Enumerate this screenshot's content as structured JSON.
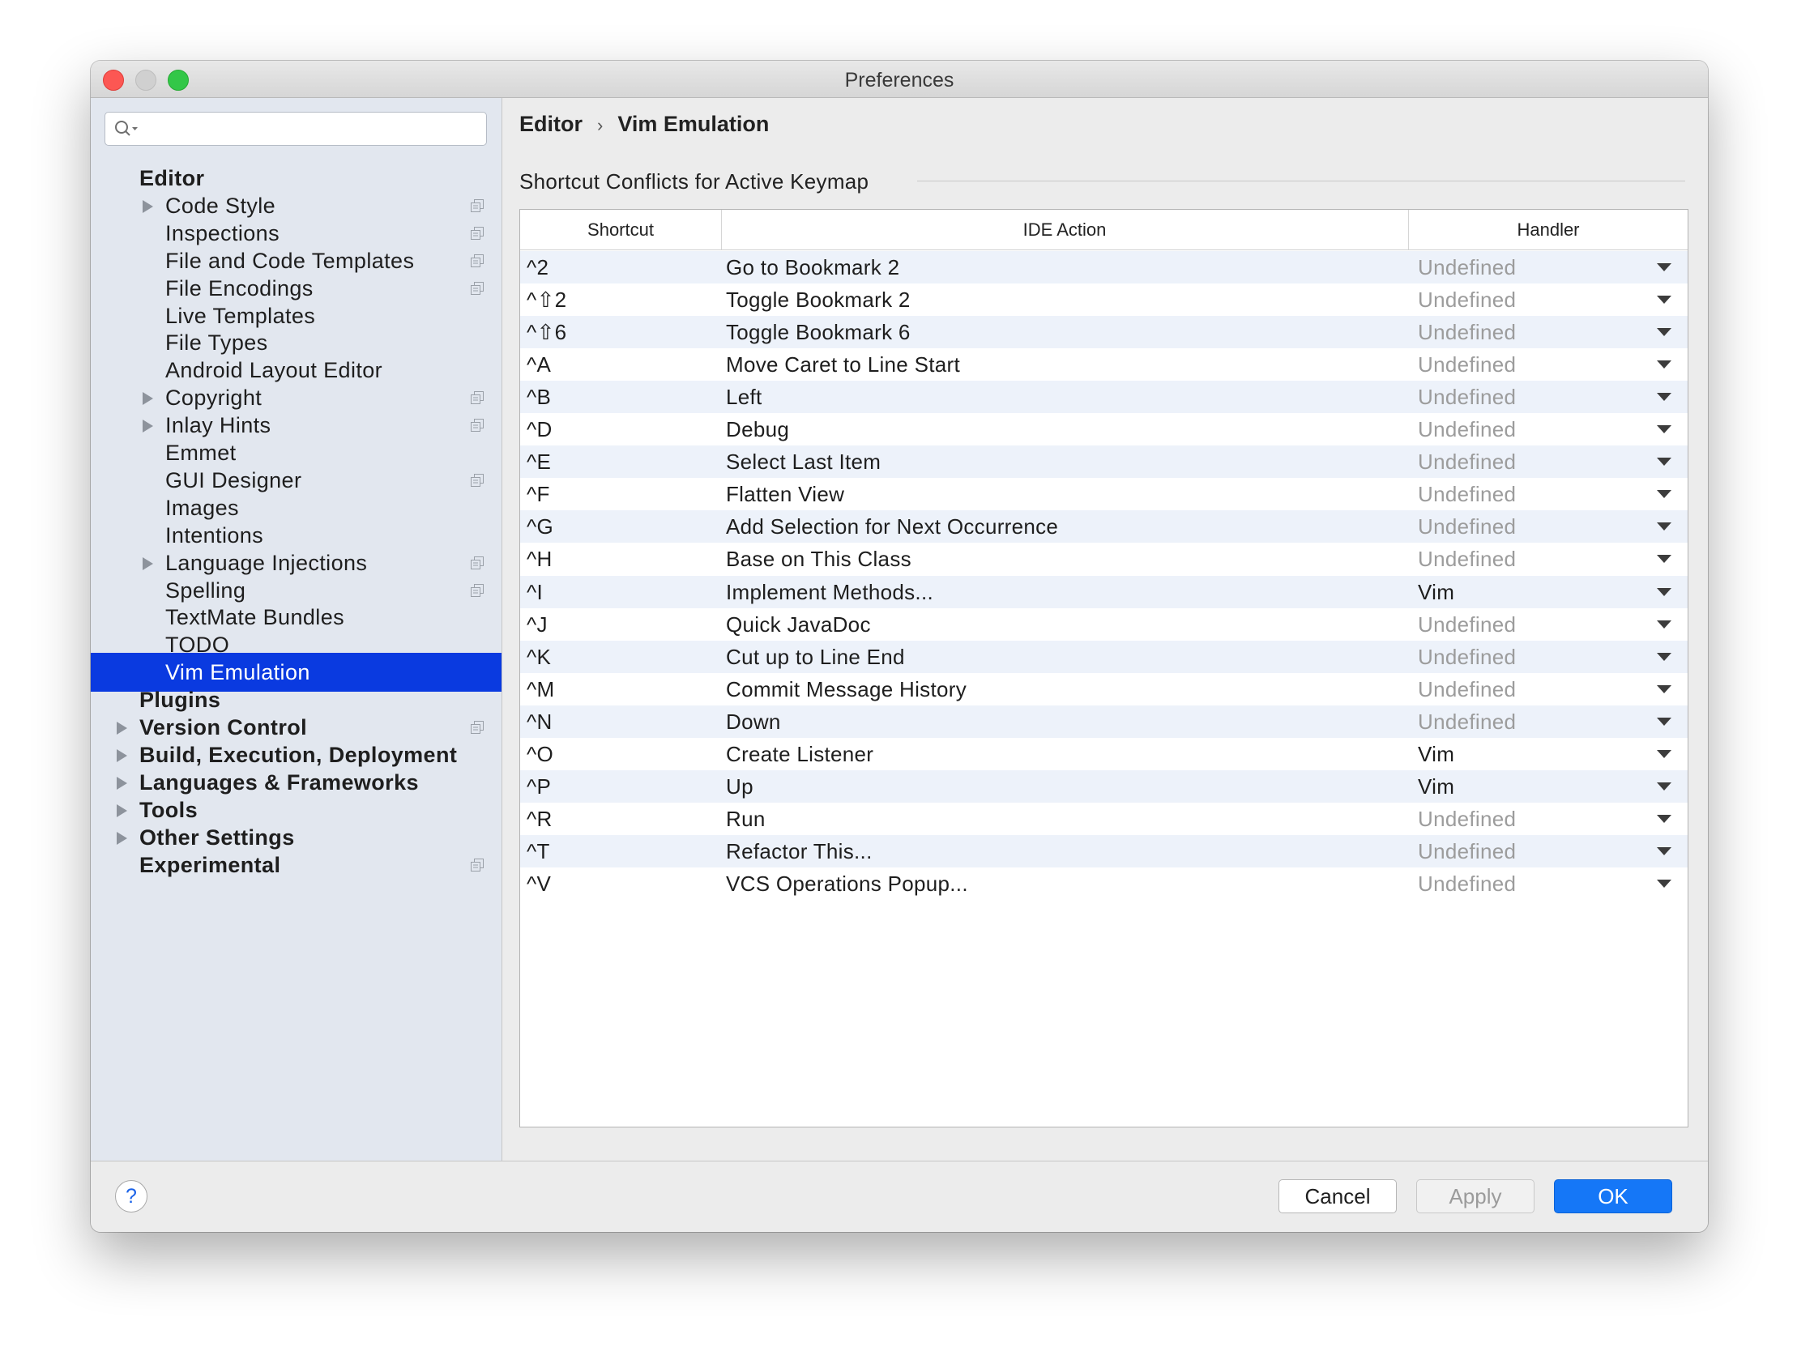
{
  "window": {
    "title": "Preferences"
  },
  "search": {
    "placeholder": ""
  },
  "sidebar": {
    "items": [
      {
        "label": "Editor",
        "level": "top",
        "arrow": false,
        "project": false,
        "selected": false
      },
      {
        "label": "Code Style",
        "level": "sub",
        "arrow": true,
        "project": true,
        "selected": false
      },
      {
        "label": "Inspections",
        "level": "sub",
        "arrow": false,
        "project": true,
        "selected": false
      },
      {
        "label": "File and Code Templates",
        "level": "sub",
        "arrow": false,
        "project": true,
        "selected": false
      },
      {
        "label": "File Encodings",
        "level": "sub",
        "arrow": false,
        "project": true,
        "selected": false
      },
      {
        "label": "Live Templates",
        "level": "sub",
        "arrow": false,
        "project": false,
        "selected": false
      },
      {
        "label": "File Types",
        "level": "sub",
        "arrow": false,
        "project": false,
        "selected": false
      },
      {
        "label": "Android Layout Editor",
        "level": "sub",
        "arrow": false,
        "project": false,
        "selected": false
      },
      {
        "label": "Copyright",
        "level": "sub",
        "arrow": true,
        "project": true,
        "selected": false
      },
      {
        "label": "Inlay Hints",
        "level": "sub",
        "arrow": true,
        "project": true,
        "selected": false
      },
      {
        "label": "Emmet",
        "level": "sub",
        "arrow": false,
        "project": false,
        "selected": false
      },
      {
        "label": "GUI Designer",
        "level": "sub",
        "arrow": false,
        "project": true,
        "selected": false
      },
      {
        "label": "Images",
        "level": "sub",
        "arrow": false,
        "project": false,
        "selected": false
      },
      {
        "label": "Intentions",
        "level": "sub",
        "arrow": false,
        "project": false,
        "selected": false
      },
      {
        "label": "Language Injections",
        "level": "sub",
        "arrow": true,
        "project": true,
        "selected": false
      },
      {
        "label": "Spelling",
        "level": "sub",
        "arrow": false,
        "project": true,
        "selected": false
      },
      {
        "label": "TextMate Bundles",
        "level": "sub",
        "arrow": false,
        "project": false,
        "selected": false
      },
      {
        "label": "TODO",
        "level": "sub",
        "arrow": false,
        "project": false,
        "selected": false
      },
      {
        "label": "Vim Emulation",
        "level": "sub",
        "arrow": false,
        "project": false,
        "selected": true
      },
      {
        "label": "Plugins",
        "level": "top",
        "arrow": false,
        "project": false,
        "selected": false
      },
      {
        "label": "Version Control",
        "level": "top",
        "arrow": true,
        "project": true,
        "selected": false
      },
      {
        "label": "Build, Execution, Deployment",
        "level": "top",
        "arrow": true,
        "project": false,
        "selected": false
      },
      {
        "label": "Languages & Frameworks",
        "level": "top",
        "arrow": true,
        "project": false,
        "selected": false
      },
      {
        "label": "Tools",
        "level": "top",
        "arrow": true,
        "project": false,
        "selected": false
      },
      {
        "label": "Other Settings",
        "level": "top",
        "arrow": true,
        "project": false,
        "selected": false
      },
      {
        "label": "Experimental",
        "level": "top",
        "arrow": false,
        "project": true,
        "selected": false
      }
    ]
  },
  "breadcrumb": {
    "parent": "Editor",
    "separator": "›",
    "current": "Vim Emulation"
  },
  "section": {
    "title": "Shortcut Conflicts for Active Keymap"
  },
  "table": {
    "headers": {
      "shortcut": "Shortcut",
      "action": "IDE Action",
      "handler": "Handler"
    },
    "rows": [
      {
        "shortcut": "^2",
        "action": "Go to Bookmark 2",
        "handler": "Undefined"
      },
      {
        "shortcut": "^⇧2",
        "action": "Toggle Bookmark 2",
        "handler": "Undefined"
      },
      {
        "shortcut": "^⇧6",
        "action": "Toggle Bookmark 6",
        "handler": "Undefined"
      },
      {
        "shortcut": "^A",
        "action": "Move Caret to Line Start",
        "handler": "Undefined"
      },
      {
        "shortcut": "^B",
        "action": "Left",
        "handler": "Undefined"
      },
      {
        "shortcut": "^D",
        "action": "Debug",
        "handler": "Undefined"
      },
      {
        "shortcut": "^E",
        "action": "Select Last Item",
        "handler": "Undefined"
      },
      {
        "shortcut": "^F",
        "action": "Flatten View",
        "handler": "Undefined"
      },
      {
        "shortcut": "^G",
        "action": "Add Selection for Next Occurrence",
        "handler": "Undefined"
      },
      {
        "shortcut": "^H",
        "action": "Base on This Class",
        "handler": "Undefined"
      },
      {
        "shortcut": "^I",
        "action": "Implement Methods...",
        "handler": "Vim"
      },
      {
        "shortcut": "^J",
        "action": "Quick JavaDoc",
        "handler": "Undefined"
      },
      {
        "shortcut": "^K",
        "action": "Cut up to Line End",
        "handler": "Undefined"
      },
      {
        "shortcut": "^M",
        "action": "Commit Message History",
        "handler": "Undefined"
      },
      {
        "shortcut": "^N",
        "action": "Down",
        "handler": "Undefined"
      },
      {
        "shortcut": "^O",
        "action": "Create Listener",
        "handler": "Vim"
      },
      {
        "shortcut": "^P",
        "action": "Up",
        "handler": "Vim"
      },
      {
        "shortcut": "^R",
        "action": "Run",
        "handler": "Undefined"
      },
      {
        "shortcut": "^T",
        "action": "Refactor This...",
        "handler": "Undefined"
      },
      {
        "shortcut": "^V",
        "action": "VCS Operations Popup...",
        "handler": "Undefined"
      }
    ]
  },
  "footer": {
    "help_label": "?",
    "cancel_label": "Cancel",
    "apply_label": "Apply",
    "ok_label": "OK"
  },
  "colors": {
    "selection": "#0a3ae0",
    "ok_button": "#1577f7",
    "undefined_text": "#9c9c9c"
  }
}
